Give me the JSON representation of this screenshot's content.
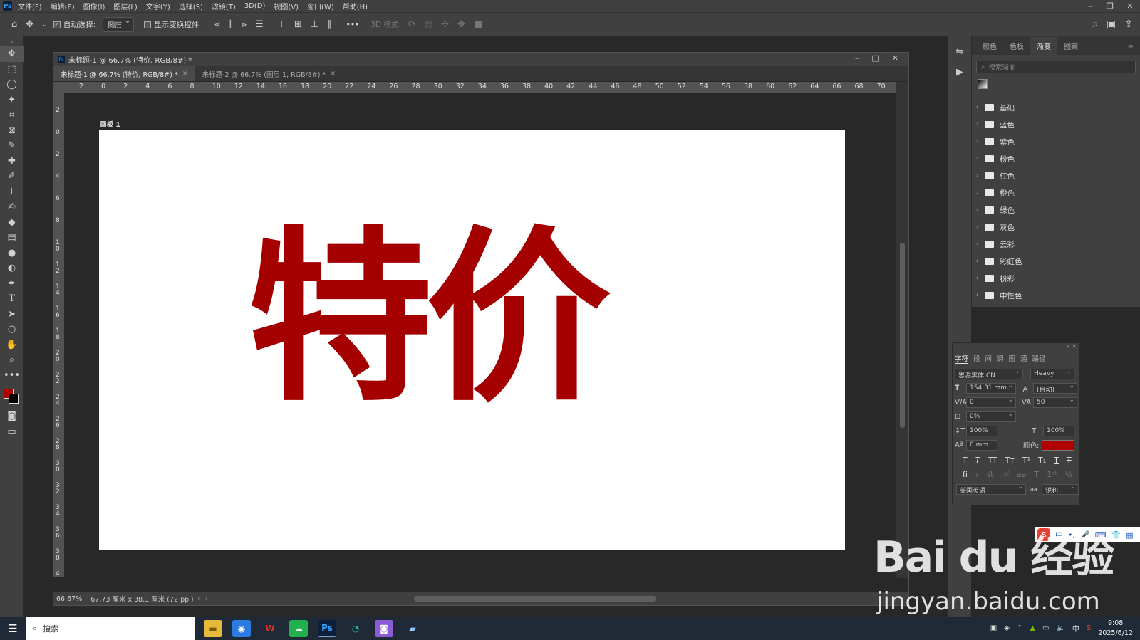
{
  "menubar": {
    "items": [
      "文件(F)",
      "编辑(E)",
      "图像(I)",
      "图层(L)",
      "文字(Y)",
      "选择(S)",
      "滤镜(T)",
      "3D(D)",
      "视图(V)",
      "窗口(W)",
      "帮助(H)"
    ]
  },
  "options": {
    "auto_select_label": "自动选择:",
    "auto_select_value": "图层",
    "show_transform_label": "显示变换控件",
    "mode_3d_label": "3D 模式:",
    "more": "•••"
  },
  "document": {
    "window_title": "未标题-1 @ 66.7% (特价, RGB/8#) *",
    "tabs": [
      {
        "label": "未标题-1 @ 66.7% (特价, RGB/8#) *",
        "active": true
      },
      {
        "label": "未标题-2 @ 66.7% (图层 1, RGB/8#) *",
        "active": false
      }
    ],
    "artboard_label": "画板 1",
    "canvas_text": "特价",
    "canvas_text_color": "#a50000",
    "ruler_h": [
      "2",
      "0",
      "2",
      "4",
      "6",
      "8",
      "10",
      "12",
      "14",
      "16",
      "18",
      "20",
      "22",
      "24",
      "26",
      "28",
      "30",
      "32",
      "34",
      "36",
      "38",
      "40",
      "42",
      "44",
      "46",
      "48",
      "50",
      "52",
      "54",
      "56",
      "58",
      "60",
      "62",
      "64",
      "66",
      "68",
      "70"
    ],
    "ruler_v": [
      "2",
      "0",
      "2",
      "4",
      "6",
      "8",
      "1 0",
      "1 2",
      "1 4",
      "1 6",
      "1 8",
      "2 0",
      "2 2",
      "2 4",
      "2 6",
      "2 8",
      "3 0",
      "3 2",
      "3 4",
      "3 6",
      "3 8",
      "4 0"
    ],
    "status_zoom": "66.67%",
    "status_size": "67.73 厘米 x 38.1 厘米 (72 ppi)"
  },
  "swatches_panel": {
    "tabs": [
      "颜色",
      "色板",
      "渐变",
      "图案"
    ],
    "active_tab": "渐变",
    "search_placeholder": "搜索渐变",
    "folders": [
      "基础",
      "蓝色",
      "紫色",
      "粉色",
      "红色",
      "橙色",
      "绿色",
      "灰色",
      "云彩",
      "彩虹色",
      "粉彩",
      "中性色"
    ]
  },
  "character_panel": {
    "tabs": [
      "字符",
      "段",
      "间",
      "调",
      "图",
      "通",
      "路径"
    ],
    "font_family": "思源黑体 CN",
    "font_style": "Heavy",
    "font_size": "154.31 mm",
    "leading": "(自动)",
    "kerning": "0",
    "tracking": "50",
    "tsume": "0%",
    "vertical_scale": "100%",
    "horizontal_scale": "100%",
    "baseline_shift": "0 mm",
    "color_label": "颜色:",
    "color_value": "#b00000",
    "language": "美国英语",
    "aa_label": "aa",
    "antialias": "锐利"
  },
  "ime": {
    "lang": "中"
  },
  "watermark": {
    "main": "Bai du 经验",
    "sub": "jingyan.baidu.com"
  },
  "taskbar": {
    "search_label": "搜索",
    "lang": "中",
    "time": "9:08",
    "date": "2025/6/12"
  }
}
